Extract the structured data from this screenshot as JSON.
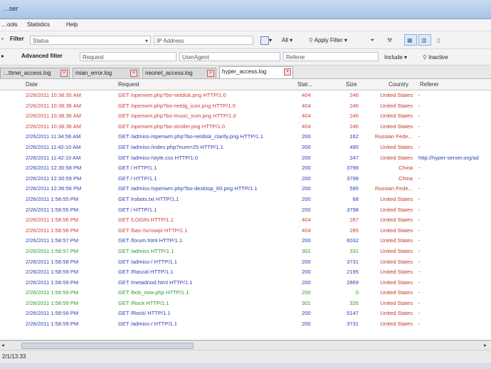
{
  "window": {
    "title": "…ser"
  },
  "menu": {
    "items": [
      "…ools",
      "Statistics",
      "Help"
    ]
  },
  "toolbar": {
    "filter_label": "Filter",
    "status_placeholder": "Status",
    "ip_placeholder": "IP Address",
    "all_label": "All",
    "apply_filter_label": "Apply Filter"
  },
  "toolbar2": {
    "advanced_filter_label": "Advanced filter",
    "request_placeholder": "Request",
    "user_agent_placeholder": "UserAgent",
    "referer_placeholder": "Referer",
    "include_label": "Include",
    "inactive_label": "Inactive"
  },
  "tabs": [
    "…ttmei_access.log",
    "mian_error.log",
    "neonet_access.log",
    "hyper_access.log"
  ],
  "columns": [
    "Date",
    "Request",
    "Stat...",
    "Size",
    "Country",
    "Referer"
  ],
  "rows": [
    {
      "date": "2/26/2011 10:38:35 AM",
      "request": "GET /openwm.php?bo-netdisk.png HTTP/1.0",
      "status": "404",
      "size": "246",
      "country": "United States",
      "referer": "-",
      "color": "#d23a3a"
    },
    {
      "date": "2/26/2011 10:38:36 AM",
      "request": "GET /openwm.php?bo-netdg_icon.png HTTP/1.0",
      "status": "404",
      "size": "246",
      "country": "United States",
      "referer": "-",
      "color": "#d23a3a"
    },
    {
      "date": "2/26/2011 10:38:36 AM",
      "request": "GET /openwm.php?bo-music_icon.png HTTP/1.0",
      "status": "404",
      "size": "246",
      "country": "United States",
      "referer": "-",
      "color": "#d23a3a"
    },
    {
      "date": "2/26/2011 10:38:36 AM",
      "request": "GET /openwm.php?bo-stroller.png HTTP/1.0",
      "status": "404",
      "size": "246",
      "country": "United States",
      "referer": "-",
      "color": "#d23a3a"
    },
    {
      "date": "2/26/2011 11:34:56 AM",
      "request": "GET /admiss-/openwm.php?bo-netdisk_clarify.png HTTP/1.1",
      "status": "200",
      "size": "162",
      "country": "Russian Fede...",
      "referer": "-",
      "color": "#2f3fb0"
    },
    {
      "date": "2/26/2011 11:42:10 AM",
      "request": "GET /admiss-/index.php?num=25 HTTP/1.1",
      "status": "200",
      "size": "495",
      "country": "United States",
      "referer": "-",
      "color": "#2f3fb0"
    },
    {
      "date": "2/26/2011 11:42:10 AM",
      "request": "GET /admiss-/style.css HTTP/1.0",
      "status": "200",
      "size": "247",
      "country": "United States",
      "referer": "http://hyper-server.org/ad",
      "color": "#2f3fb0"
    },
    {
      "date": "2/26/2011 12:30:58 PM",
      "request": "GET / HTTP/1.1",
      "status": "200",
      "size": "3798",
      "country": "China",
      "referer": "-",
      "color": "#2f3fb0"
    },
    {
      "date": "2/26/2011 12:30:59 PM",
      "request": "GET / HTTP/1.1",
      "status": "200",
      "size": "3798",
      "country": "China",
      "referer": "-",
      "color": "#2f3fb0"
    },
    {
      "date": "2/26/2011 12:36:56 PM",
      "request": "GET /admiss-/openwm.php?bo-desktop_60.png HTTP/1.1",
      "status": "200",
      "size": "595",
      "country": "Russian Fede...",
      "referer": "-",
      "color": "#2f3fb0"
    },
    {
      "date": "2/26/2011 1:58:55 PM",
      "request": "GET /robots.txt HTTP/1.1",
      "status": "200",
      "size": "68",
      "country": "United States",
      "referer": "-",
      "color": "#2f3fb0"
    },
    {
      "date": "2/26/2011 1:58:55 PM",
      "request": "GET / HTTP/1.1",
      "status": "200",
      "size": "3798",
      "country": "United States",
      "referer": "-",
      "color": "#2f3fb0"
    },
    {
      "date": "2/26/2011 1:58:56 PM",
      "request": "GET /LOGIN HTTP/1.1",
      "status": "404",
      "size": "287",
      "country": "United States",
      "referer": "-",
      "color": "#d23a3a"
    },
    {
      "date": "2/26/2011 1:58:56 PM",
      "request": "GET /bas-/scrowpt HTTP/1.1",
      "status": "404",
      "size": "285",
      "country": "United States",
      "referer": "-",
      "color": "#d23a3a"
    },
    {
      "date": "2/26/2011 1:58:57 PM",
      "request": "GET /forum.html HTTP/1.1",
      "status": "200",
      "size": "6032",
      "country": "United States",
      "referer": "-",
      "color": "#2f3fb0"
    },
    {
      "date": "2/26/2011 1:58:57 PM",
      "request": "GET /admiss HTTP/1.1",
      "status": "301",
      "size": "331",
      "country": "United States",
      "referer": "-",
      "color": "#2e9a2e"
    },
    {
      "date": "2/26/2011 1:58:58 PM",
      "request": "GET /admiss-/ HTTP/1.1",
      "status": "200",
      "size": "3731",
      "country": "United States",
      "referer": "-",
      "color": "#2f3fb0"
    },
    {
      "date": "2/26/2011 1:58:59 PM",
      "request": "GET /Rascal HTTP/1.1",
      "status": "200",
      "size": "2195",
      "country": "United States",
      "referer": "-",
      "color": "#2f3fb0"
    },
    {
      "date": "2/26/2011 1:58:59 PM",
      "request": "GET /metadnod.html HTTP/1.1",
      "status": "200",
      "size": "2869",
      "country": "United States",
      "referer": "-",
      "color": "#2f3fb0"
    },
    {
      "date": "2/26/2011 1:58:59 PM",
      "request": "GET /bob_now.php HTTP/1.1",
      "status": "200",
      "size": "0",
      "country": "United States",
      "referer": "-",
      "color": "#2e9a2e"
    },
    {
      "date": "2/26/2011 1:58:59 PM",
      "request": "GET /Rock HTTP/1.1",
      "status": "301",
      "size": "326",
      "country": "United States",
      "referer": "-",
      "color": "#2e9a2e"
    },
    {
      "date": "2/26/2011 1:58:59 PM",
      "request": "GET /Rock/ HTTP/1.1",
      "status": "200",
      "size": "5147",
      "country": "United States",
      "referer": "-",
      "color": "#2f3fb0"
    },
    {
      "date": "2/26/2011 1:58:59 PM",
      "request": "GET /admiss-/ HTTP/1.1",
      "status": "200",
      "size": "3731",
      "country": "United States",
      "referer": "-",
      "color": "#2f3fb0"
    }
  ],
  "status": {
    "text": "2/1/13:33"
  },
  "colors": {
    "error": "#d23a3a",
    "ok": "#2f3fb0",
    "redirect": "#2e9a2e",
    "country": "#c0392b"
  }
}
